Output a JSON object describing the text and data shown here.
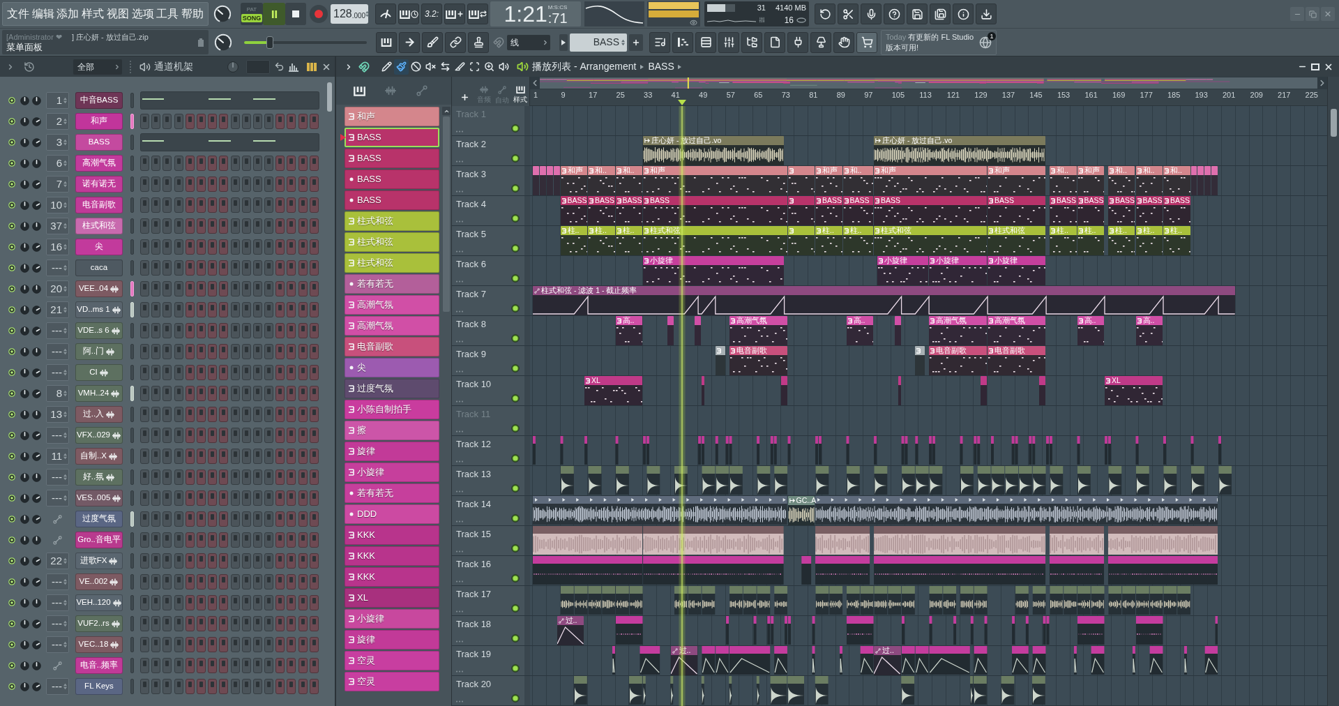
{
  "menu": [
    "文件",
    "编辑",
    "添加",
    "样式",
    "视图",
    "选项",
    "工具",
    "帮助"
  ],
  "transport": {
    "mode": [
      {
        "label": "PAT",
        "selected": false
      },
      {
        "label": "SONG",
        "selected": true
      }
    ],
    "playing": true,
    "tempo": "128",
    "tempo_decimals": ".000"
  },
  "countdown_label": "3.2:",
  "time": {
    "main": "1:21",
    "centiseconds": ":71",
    "format": "M:S:CS"
  },
  "resources": {
    "cpu": "31",
    "memory": "4140 MB",
    "polyphony": "16"
  },
  "hint": {
    "user": "[Administrator ❤",
    "project": "] 庄心妍 - 放过自己.zip",
    "panel": "菜单面板"
  },
  "pitch": {
    "level": 0.21
  },
  "snap": "线",
  "pattern_selector": "BASS",
  "news": {
    "day": "Today",
    "message": "有更新的 FL Studio 版本可用!",
    "badge": "1"
  },
  "channel_rack": {
    "filter": "全部",
    "title": "通道机架"
  },
  "channels": [
    {
      "number": "1",
      "name": "中音BASS",
      "kind": "instrument",
      "piano_roll": true,
      "color": "#6e3556",
      "selected": false,
      "highlighted": false
    },
    {
      "number": "2",
      "name": "和声",
      "kind": "instrument",
      "piano_roll": false,
      "color": "#c1359b",
      "selected": true,
      "highlighted": false
    },
    {
      "number": "3",
      "name": "BASS",
      "kind": "instrument",
      "piano_roll": true,
      "color": "#c44a9f",
      "selected": false,
      "highlighted": false
    },
    {
      "number": "6",
      "name": "高潮气氛",
      "kind": "instrument",
      "piano_roll": false,
      "color": "#c23a9c",
      "selected": false,
      "highlighted": false
    },
    {
      "number": "7",
      "name": "诺有诺无",
      "kind": "instrument",
      "piano_roll": false,
      "color": "#c03a98",
      "selected": false,
      "highlighted": false
    },
    {
      "number": "10",
      "name": "电音副歌",
      "kind": "instrument",
      "piano_roll": false,
      "color": "#c03a98",
      "selected": false,
      "highlighted": false
    },
    {
      "number": "37",
      "name": "柱式和弦",
      "kind": "instrument",
      "piano_roll": false,
      "color": "#c86aae",
      "selected": false,
      "highlighted": false
    },
    {
      "number": "16",
      "name": "尖",
      "kind": "instrument",
      "piano_roll": false,
      "color": "#c23a9c",
      "selected": false,
      "highlighted": false
    },
    {
      "number": "---",
      "name": "caca",
      "kind": "instrument",
      "piano_roll": false,
      "color": "#4e5961",
      "selected": false,
      "highlighted": false
    },
    {
      "number": "20",
      "name": "VEE..04",
      "kind": "audio",
      "piano_roll": false,
      "color": "#7d5a62",
      "selected": true,
      "highlighted": false
    },
    {
      "number": "21",
      "name": "VD..ms 1",
      "kind": "audio",
      "piano_roll": false,
      "color": "#59646d",
      "selected": false,
      "highlighted": true
    },
    {
      "number": "---",
      "name": "VDE..s 6",
      "kind": "audio",
      "piano_roll": false,
      "color": "#5d7060",
      "selected": false,
      "highlighted": false
    },
    {
      "number": "---",
      "name": "阿..门",
      "kind": "audio",
      "piano_roll": false,
      "color": "#5d7060",
      "selected": false,
      "highlighted": false
    },
    {
      "number": "---",
      "name": "CI",
      "kind": "audio",
      "piano_roll": false,
      "color": "#5d7060",
      "selected": false,
      "highlighted": false
    },
    {
      "number": "8",
      "name": "VMH..24",
      "kind": "audio",
      "piano_roll": false,
      "color": "#5d7060",
      "selected": false,
      "highlighted": true
    },
    {
      "number": "13",
      "name": "过..入",
      "kind": "audio",
      "piano_roll": false,
      "color": "#7d5a62",
      "selected": false,
      "highlighted": false
    },
    {
      "number": "---",
      "name": "VFX..029",
      "kind": "audio",
      "piano_roll": false,
      "color": "#5d7060",
      "selected": false,
      "highlighted": false
    },
    {
      "number": "11",
      "name": "自制..X",
      "kind": "audio",
      "piano_roll": false,
      "color": "#7d5a62",
      "selected": false,
      "highlighted": false
    },
    {
      "number": "---",
      "name": "好..氛",
      "kind": "audio",
      "piano_roll": false,
      "color": "#5d7060",
      "selected": false,
      "highlighted": false
    },
    {
      "number": "---",
      "name": "VES..005",
      "kind": "audio",
      "piano_roll": false,
      "color": "#735a66",
      "selected": false,
      "highlighted": false
    },
    {
      "name": "过度气氛",
      "kind": "automation",
      "piano_roll": false,
      "color": "#5a6684",
      "selected": false,
      "highlighted": true
    },
    {
      "name": "Gro..音电平",
      "kind": "automation",
      "piano_roll": false,
      "color": "#b83a8e",
      "selected": false,
      "highlighted": false
    },
    {
      "number": "22",
      "name": "进歌FX",
      "kind": "audio",
      "piano_roll": false,
      "color": "#5a6670",
      "selected": false,
      "highlighted": false
    },
    {
      "number": "---",
      "name": "VE..002",
      "kind": "audio",
      "piano_roll": false,
      "color": "#7d5a62",
      "selected": false,
      "highlighted": false
    },
    {
      "number": "---",
      "name": "VEH..120",
      "kind": "audio",
      "piano_roll": false,
      "color": "#5a6670",
      "selected": false,
      "highlighted": false
    },
    {
      "number": "---",
      "name": "VUF2..rs",
      "kind": "audio",
      "piano_roll": false,
      "color": "#5d7060",
      "selected": false,
      "highlighted": false
    },
    {
      "number": "---",
      "name": "VEC..18",
      "kind": "audio",
      "piano_roll": false,
      "color": "#7d5a62",
      "selected": false,
      "highlighted": false
    },
    {
      "name": "电音..频率",
      "kind": "automation",
      "piano_roll": false,
      "color": "#c03a98",
      "selected": false,
      "highlighted": false
    },
    {
      "number": "---",
      "name": "FL Keys",
      "kind": "instrument",
      "piano_roll": false,
      "color": "#5a6684",
      "selected": false,
      "highlighted": false
    }
  ],
  "playlist": {
    "title": "播放列表 - Arrangement",
    "pattern": "BASS"
  },
  "tools": [
    {
      "kind": "draw",
      "selected": false
    },
    {
      "kind": "paint",
      "selected": true
    },
    {
      "kind": "delete",
      "selected": false
    },
    {
      "kind": "mute",
      "selected": false
    },
    {
      "kind": "slip",
      "selected": false
    },
    {
      "kind": "slice",
      "selected": false
    },
    {
      "kind": "select",
      "selected": false
    },
    {
      "kind": "zoom",
      "selected": false
    },
    {
      "kind": "playback",
      "selected": false
    }
  ],
  "picker_filters": [
    {
      "kind": "patterns",
      "selected": true
    },
    {
      "kind": "audio",
      "selected": false
    },
    {
      "kind": "automation",
      "selected": false
    }
  ],
  "patterns": [
    {
      "name": "和声",
      "kind": "pattern",
      "color": "#d4868c",
      "selected": false
    },
    {
      "name": "BASS",
      "kind": "pattern",
      "color": "#b8336a",
      "selected": true
    },
    {
      "name": "BASS",
      "kind": "pattern",
      "color": "#b8336a",
      "selected": false
    },
    {
      "name": "BASS",
      "kind": "dot",
      "color": "#b8336a",
      "selected": false
    },
    {
      "name": "BASS",
      "kind": "dot",
      "color": "#b8336a",
      "selected": false
    },
    {
      "name": "柱式和弦",
      "kind": "pattern",
      "color": "#a9c03b",
      "selected": false
    },
    {
      "name": "柱式和弦",
      "kind": "pattern",
      "color": "#a9c03b",
      "selected": false
    },
    {
      "name": "柱式和弦",
      "kind": "pattern",
      "color": "#a9c03b",
      "selected": false
    },
    {
      "name": "若有若无",
      "kind": "dot",
      "color": "#b35f9a",
      "selected": false
    },
    {
      "name": "高潮气氛",
      "kind": "pattern",
      "color": "#d14fa6",
      "selected": false
    },
    {
      "name": "高潮气氛",
      "kind": "pattern",
      "color": "#d14fa6",
      "selected": false
    },
    {
      "name": "电音副歌",
      "kind": "pattern",
      "color": "#c8507c",
      "selected": false
    },
    {
      "name": "尖",
      "kind": "dot",
      "color": "#9c5bb0",
      "selected": false
    },
    {
      "name": "过度气氛",
      "kind": "pattern",
      "color": "#5e4b6e",
      "selected": false
    },
    {
      "name": "小陈自制拍手",
      "kind": "pattern",
      "color": "#c93c9e",
      "selected": false
    },
    {
      "name": "擦",
      "kind": "pattern",
      "color": "#cc55a8",
      "selected": false
    },
    {
      "name": "旋律",
      "kind": "pattern",
      "color": "#c23a98",
      "selected": false
    },
    {
      "name": "小旋律",
      "kind": "pattern",
      "color": "#c63f9c",
      "selected": false
    },
    {
      "name": "若有若无",
      "kind": "dot",
      "color": "#c63f9c",
      "selected": false
    },
    {
      "name": "DDD",
      "kind": "dot",
      "color": "#cc4aa2",
      "selected": false
    },
    {
      "name": "KKK",
      "kind": "pattern",
      "color": "#b8348c",
      "selected": false
    },
    {
      "name": "KKK",
      "kind": "pattern",
      "color": "#b8348c",
      "selected": false
    },
    {
      "name": "KKK",
      "kind": "pattern",
      "color": "#b8348c",
      "selected": false
    },
    {
      "name": "XL",
      "kind": "pattern",
      "color": "#a8307e",
      "selected": false
    },
    {
      "name": "小旋律",
      "kind": "pattern",
      "color": "#c8489e",
      "selected": false
    },
    {
      "name": "旋律",
      "kind": "pattern",
      "color": "#c23a98",
      "selected": false
    },
    {
      "name": "空灵",
      "kind": "pattern",
      "color": "#c83ea0",
      "selected": false
    },
    {
      "name": "空灵",
      "kind": "pattern",
      "color": "#c83ea0",
      "selected": false
    }
  ],
  "track_filters": [
    {
      "kind": "audio",
      "label": "音频",
      "selected": false
    },
    {
      "kind": "automation",
      "label": "自动",
      "selected": false
    },
    {
      "kind": "patterns",
      "label": "样式",
      "selected": true
    }
  ],
  "ruler": [
    "1",
    "9",
    "17",
    "25",
    "33",
    "41",
    "49",
    "57",
    "65",
    "73",
    "81",
    "89",
    "97",
    "105",
    "113",
    "121",
    "129",
    "137",
    "145",
    "153",
    "161",
    "169",
    "177",
    "185",
    "193",
    "201",
    "209",
    "217",
    "225"
  ],
  "playhead": {
    "level": 0.19
  },
  "tracks": [
    {
      "name": "Track 1",
      "disabled": true
    },
    {
      "name": "Track 2",
      "disabled": false,
      "clips": [
        {
          "kind": "audio",
          "label": "庄心妍 - 放过自己.vo",
          "color": "#7b7a5c"
        },
        {
          "kind": "audio",
          "label": "庄心妍 - 放过自己.vo",
          "color": "#7b7a5c"
        }
      ]
    },
    {
      "name": "Track 3",
      "disabled": false,
      "clips": [
        {
          "kind": "pattern",
          "color": "#df6fae"
        },
        {
          "kind": "pattern",
          "color": "#df6fae"
        },
        {
          "kind": "pattern",
          "color": "#df6fae"
        },
        {
          "kind": "pattern",
          "color": "#df6fae"
        },
        {
          "kind": "pattern",
          "label": "和声",
          "color": "#d4868c"
        },
        {
          "kind": "pattern",
          "label": "和..",
          "color": "#d4868c"
        },
        {
          "kind": "pattern",
          "label": "和..",
          "color": "#d4868c"
        },
        {
          "kind": "pattern",
          "label": "和声",
          "color": "#d4868c"
        },
        {
          "kind": "pattern",
          "color": "#d4868c"
        },
        {
          "kind": "pattern",
          "label": "和声",
          "color": "#d4868c"
        },
        {
          "kind": "pattern",
          "label": "和..",
          "color": "#d4868c"
        },
        {
          "kind": "pattern",
          "label": "和声",
          "color": "#d4868c"
        },
        {
          "kind": "pattern",
          "label": "和声",
          "color": "#d4868c"
        },
        {
          "kind": "pattern",
          "label": "和..",
          "color": "#d4868c"
        },
        {
          "kind": "pattern",
          "label": "和声",
          "color": "#d4868c"
        },
        {
          "kind": "pattern",
          "label": "和..",
          "color": "#d4868c"
        },
        {
          "kind": "pattern",
          "label": "和..",
          "color": "#d4868c"
        },
        {
          "kind": "pattern",
          "label": "和..",
          "color": "#d4868c"
        },
        {
          "kind": "pattern",
          "color": "#df6fae"
        },
        {
          "kind": "pattern",
          "color": "#df6fae"
        },
        {
          "kind": "pattern",
          "color": "#df6fae"
        },
        {
          "kind": "pattern",
          "color": "#df6fae"
        }
      ]
    },
    {
      "name": "Track 4",
      "disabled": false,
      "clips": [
        {
          "kind": "pattern",
          "label": "BASS",
          "color": "#b8336a"
        },
        {
          "kind": "pattern",
          "label": "BASS",
          "color": "#b8336a"
        },
        {
          "kind": "pattern",
          "label": "BASS",
          "color": "#b8336a"
        },
        {
          "kind": "pattern",
          "label": "BASS",
          "color": "#b8336a"
        },
        {
          "kind": "pattern",
          "color": "#b8336a"
        },
        {
          "kind": "pattern",
          "label": "BASS",
          "color": "#b8336a"
        },
        {
          "kind": "pattern",
          "label": "BASS",
          "color": "#b8336a"
        },
        {
          "kind": "pattern",
          "label": "BASS",
          "color": "#b8336a"
        },
        {
          "kind": "pattern",
          "label": "BASS",
          "color": "#b8336a"
        },
        {
          "kind": "pattern",
          "label": "BASS",
          "color": "#b8336a"
        },
        {
          "kind": "pattern",
          "label": "BASS",
          "color": "#b8336a"
        },
        {
          "kind": "pattern",
          "label": "BASS",
          "color": "#b8336a"
        },
        {
          "kind": "pattern",
          "label": "BASS",
          "color": "#b8336a"
        },
        {
          "kind": "pattern",
          "label": "BASS",
          "color": "#b8336a"
        }
      ]
    },
    {
      "name": "Track 5",
      "disabled": false,
      "clips": [
        {
          "kind": "pattern",
          "label": "柱..",
          "color": "#a9c03b"
        },
        {
          "kind": "pattern",
          "label": "柱..",
          "color": "#a9c03b"
        },
        {
          "kind": "pattern",
          "label": "柱..",
          "color": "#a9c03b"
        },
        {
          "kind": "pattern",
          "label": "柱式和弦",
          "color": "#a9c03b"
        },
        {
          "kind": "pattern",
          "color": "#a9c03b"
        },
        {
          "kind": "pattern",
          "label": "柱..",
          "color": "#a9c03b"
        },
        {
          "kind": "pattern",
          "label": "柱..",
          "color": "#a9c03b"
        },
        {
          "kind": "pattern",
          "label": "柱式和弦",
          "color": "#a9c03b"
        },
        {
          "kind": "pattern",
          "label": "柱式和弦",
          "color": "#a9c03b"
        },
        {
          "kind": "pattern",
          "label": "柱..",
          "color": "#a9c03b"
        },
        {
          "kind": "pattern",
          "label": "柱..",
          "color": "#a9c03b"
        },
        {
          "kind": "pattern",
          "label": "柱..",
          "color": "#a9c03b"
        },
        {
          "kind": "pattern",
          "label": "柱..",
          "color": "#a9c03b"
        },
        {
          "kind": "pattern",
          "label": "柱..",
          "color": "#a9c03b"
        }
      ]
    },
    {
      "name": "Track 6",
      "disabled": false,
      "clips": [
        {
          "kind": "pattern",
          "label": "小旋律",
          "color": "#c63f9c"
        },
        {
          "kind": "pattern",
          "label": "小旋律",
          "color": "#c63f9c"
        },
        {
          "kind": "pattern",
          "label": "小旋律",
          "color": "#c63f9c"
        },
        {
          "kind": "pattern",
          "label": "小旋律",
          "color": "#c63f9c"
        }
      ]
    },
    {
      "name": "Track 7",
      "disabled": false,
      "clips": [
        {
          "kind": "automation",
          "label": "柱式和弦 - 滤波 1 - 截止频率",
          "color": "#8e4a80"
        }
      ]
    },
    {
      "name": "Track 8",
      "disabled": false,
      "clips": [
        {
          "kind": "pattern",
          "label": "高..",
          "color": "#d14fa6"
        },
        {
          "kind": "pattern",
          "color": "#d14fa6"
        },
        {
          "kind": "pattern",
          "color": "#d14fa6"
        },
        {
          "kind": "pattern",
          "label": "高潮气氛",
          "color": "#d14fa6"
        },
        {
          "kind": "pattern",
          "label": "高..",
          "color": "#d14fa6"
        },
        {
          "kind": "pattern",
          "color": "#d14fa6"
        },
        {
          "kind": "pattern",
          "label": "高潮气氛",
          "color": "#d14fa6"
        },
        {
          "kind": "pattern",
          "label": "高潮气氛",
          "color": "#d14fa6"
        },
        {
          "kind": "pattern",
          "label": "高..",
          "color": "#d14fa6"
        },
        {
          "kind": "pattern",
          "label": "高..",
          "color": "#d14fa6"
        }
      ]
    },
    {
      "name": "Track 9",
      "disabled": false,
      "clips": [
        {
          "kind": "pattern",
          "color": "#a8b0b4"
        },
        {
          "kind": "pattern",
          "label": "电音副歌",
          "color": "#c8507c"
        },
        {
          "kind": "pattern",
          "color": "#a8b0b4"
        },
        {
          "kind": "pattern",
          "label": "电音副歌",
          "color": "#c8507c"
        },
        {
          "kind": "pattern",
          "label": "电音副歌",
          "color": "#c8507c"
        }
      ]
    },
    {
      "name": "Track 10",
      "disabled": false,
      "clips": [
        {
          "kind": "pattern",
          "label": "XL",
          "color": "#c03a88"
        },
        {
          "kind": "pattern",
          "color": "#c03a88"
        },
        {
          "kind": "pattern",
          "color": "#c03a88"
        },
        {
          "kind": "pattern",
          "color": "#c03a88"
        },
        {
          "kind": "pattern",
          "color": "#c03a88"
        },
        {
          "kind": "pattern",
          "color": "#c03a88"
        },
        {
          "kind": "pattern",
          "label": "XL",
          "color": "#c03a88"
        }
      ]
    },
    {
      "name": "Track 11",
      "disabled": true
    },
    {
      "name": "Track 12",
      "disabled": false,
      "lane": {
        "kind": "hits",
        "color": "#c03a98"
      }
    },
    {
      "name": "Track 13",
      "disabled": false,
      "lane": {
        "kind": "oneshots",
        "color": "#6b7d62"
      }
    },
    {
      "name": "Track 14",
      "disabled": false,
      "lane": {
        "kind": "loop",
        "color": "#5f6b7c"
      },
      "clips": [
        {
          "kind": "audio",
          "label": "GC..A",
          "color": "#6f8a80"
        }
      ]
    },
    {
      "name": "Track 15",
      "disabled": false,
      "lane": {
        "kind": "long_audio",
        "color": "#7a5f63"
      }
    },
    {
      "name": "Track 16",
      "disabled": false,
      "lane": {
        "kind": "blocks",
        "color": "#c43c9e"
      }
    },
    {
      "name": "Track 17",
      "disabled": false,
      "lane": {
        "kind": "small_audio",
        "color": "#6b7d62"
      }
    },
    {
      "name": "Track 18",
      "disabled": false,
      "lane": {
        "kind": "blocks",
        "color": "#c43c9e"
      },
      "clips": [
        {
          "kind": "automation",
          "label": "过..",
          "color": "#8e4a80"
        }
      ]
    },
    {
      "name": "Track 19",
      "disabled": false,
      "lane": {
        "kind": "mixed",
        "color": "#c43c9e"
      },
      "clips": [
        {
          "kind": "automation",
          "label": "过..",
          "color": "#8e4a80"
        },
        {
          "kind": "automation",
          "label": "过..",
          "color": "#8e4a80"
        }
      ]
    },
    {
      "name": "Track 20",
      "disabled": false,
      "lane": {
        "kind": "oneshots",
        "color": "#6b7d62"
      }
    }
  ]
}
